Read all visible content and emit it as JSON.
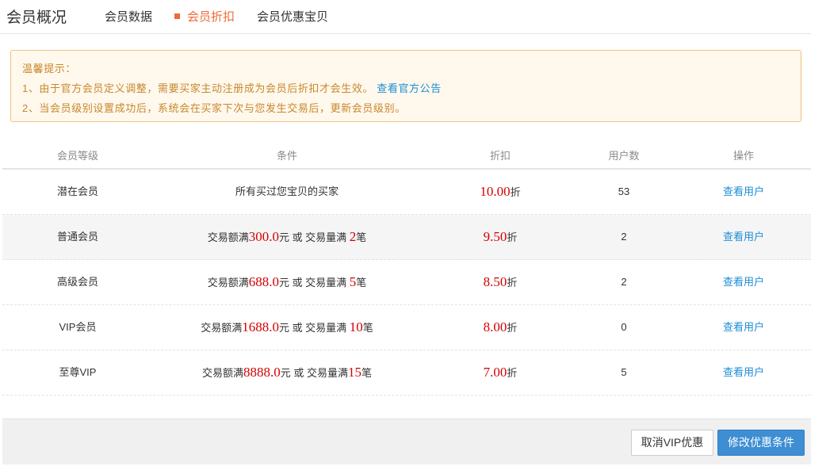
{
  "nav": {
    "title": "会员概况",
    "tabs": [
      {
        "label": "会员数据"
      },
      {
        "label": "会员折扣"
      },
      {
        "label": "会员优惠宝贝"
      }
    ],
    "active_tab": "会员折扣"
  },
  "notice": {
    "heading": "温馨提示：",
    "line1": "1、由于官方会员定义调整，需要买家主动注册成为会员后折扣才会生效。",
    "line1_link": "查看官方公告",
    "line2": "2、当会员级别设置成功后，系统会在买家下次与您发生交易后，更新会员级别。"
  },
  "table": {
    "headers": [
      "会员等级",
      "条件",
      "折扣",
      "用户数",
      "操作"
    ],
    "rows": [
      {
        "level": "潜在会员",
        "cond_text": "所有买过您宝贝的买家",
        "discount": "10.00",
        "discount_unit": "折",
        "users": "53",
        "action": "查看用户"
      },
      {
        "level": "普通会员",
        "cond_prefix": "交易额满",
        "amount": "300.0",
        "cond_mid": "元 或 交易量满 ",
        "count": "2",
        "cond_suffix": "笔",
        "discount": "9.50",
        "discount_unit": "折",
        "users": "2",
        "action": "查看用户"
      },
      {
        "level": "高级会员",
        "cond_prefix": "交易额满",
        "amount": "688.0",
        "cond_mid": "元 或 交易量满 ",
        "count": "5",
        "cond_suffix": "笔",
        "discount": "8.50",
        "discount_unit": "折",
        "users": "2",
        "action": "查看用户"
      },
      {
        "level": "VIP会员",
        "cond_prefix": "交易额满",
        "amount": "1688.0",
        "cond_mid": "元 或 交易量满 ",
        "count": "10",
        "cond_suffix": "笔",
        "discount": "8.00",
        "discount_unit": "折",
        "users": "0",
        "action": "查看用户"
      },
      {
        "level": "至尊VIP",
        "cond_prefix": "交易额满",
        "amount": "8888.0",
        "cond_mid": "元 或 交易量满",
        "count": "15",
        "cond_suffix": "笔",
        "discount": "7.00",
        "discount_unit": "折",
        "users": "5",
        "action": "查看用户"
      }
    ]
  },
  "footer": {
    "cancel_label": "取消VIP优惠",
    "edit_label": "修改优惠条件"
  },
  "colors": {
    "accent": "#f06a35",
    "link": "#1b8ed6",
    "highlight_red": "#d40000",
    "primary_button": "#3d8ed3",
    "notice_bg": "#fff8ec",
    "notice_text": "#c8872e"
  }
}
